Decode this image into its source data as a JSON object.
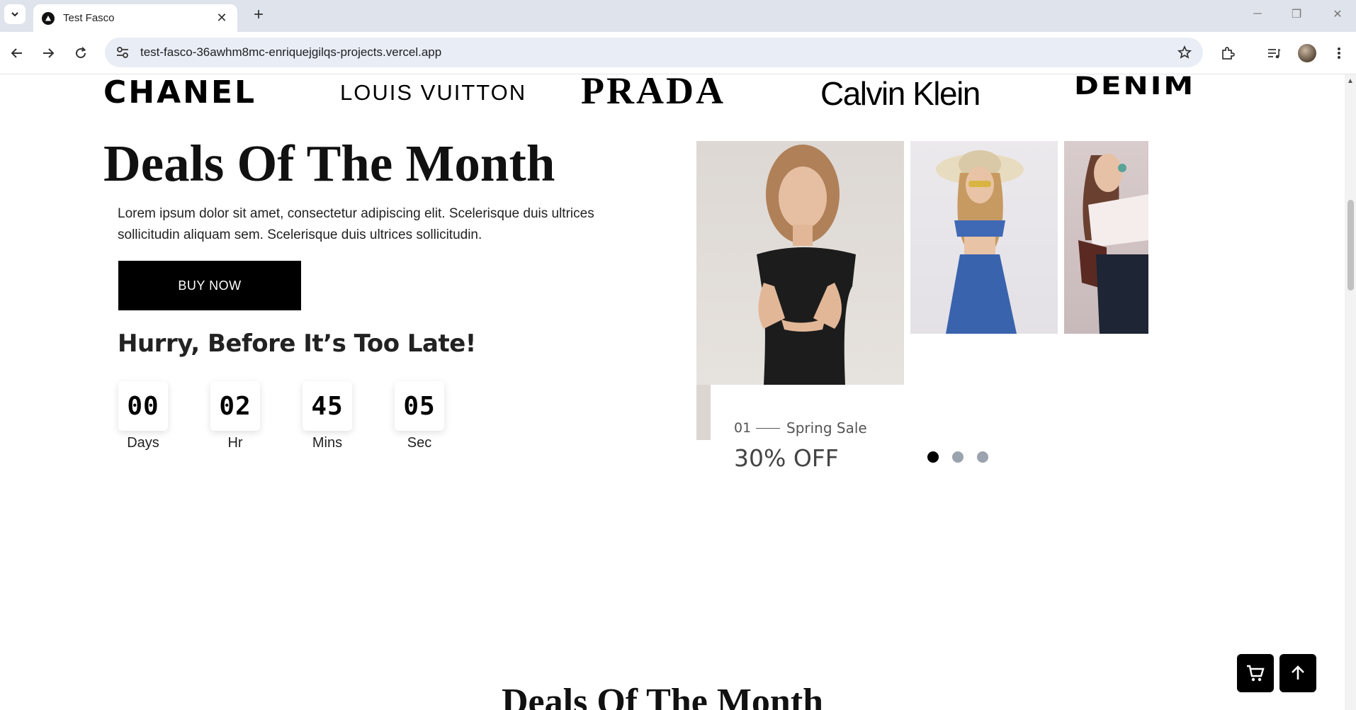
{
  "browser": {
    "tab_title": "Test Fasco",
    "url": "test-fasco-36awhm8mc-enriquejgilqs-projects.vercel.app"
  },
  "brands": [
    "CHANEL",
    "LOUIS VUITTON",
    "PRADA",
    "Calvin Klein",
    "DENIM"
  ],
  "deals": {
    "title": "Deals Of The Month",
    "description": "Lorem ipsum dolor sit amet, consectetur adipiscing elit. Scelerisque duis ultrices sollicitudin aliquam sem. Scelerisque duis ultrices sollicitudin.",
    "buy_label": "BUY NOW",
    "hurry_text": "Hurry, Before It’s Too Late!",
    "countdown": [
      {
        "value": "00",
        "label": "Days"
      },
      {
        "value": "02",
        "label": "Hr"
      },
      {
        "value": "45",
        "label": "Mins"
      },
      {
        "value": "05",
        "label": "Sec"
      }
    ]
  },
  "slider": {
    "index": "01",
    "name": "Spring Sale",
    "discount": "30% OFF",
    "dots": 3,
    "active_dot": 0
  },
  "next_section": {
    "title": "Deals Of The Month"
  },
  "colors": {
    "accent": "#000000",
    "dot_inactive": "#9aa3ae"
  }
}
